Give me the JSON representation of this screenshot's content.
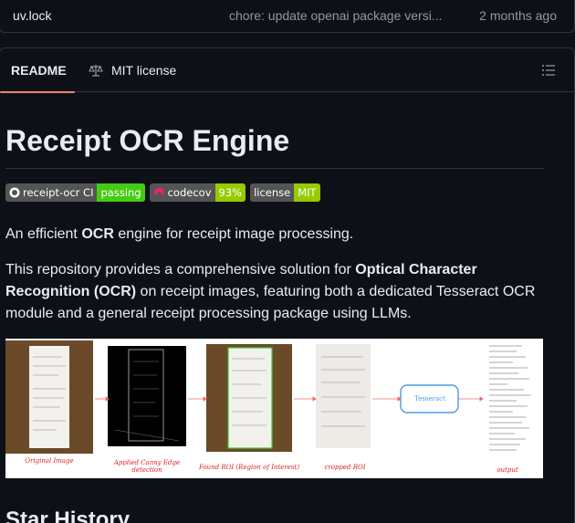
{
  "file_row": {
    "name": "uv.lock",
    "commit_message": "chore: update openai package versi...",
    "age": "2 months ago"
  },
  "tabs": {
    "readme": {
      "label": "README",
      "icon": "book-icon"
    },
    "license": {
      "label": "MIT license",
      "icon": "scale-icon"
    },
    "toc_icon": "list-icon"
  },
  "readme": {
    "title": "Receipt OCR Engine",
    "badges": [
      {
        "left": "receipt-ocr CI",
        "right": "passing",
        "color": "#4c1",
        "icon": "github-icon"
      },
      {
        "left": "codecov",
        "right": "93%",
        "color": "#97ca00",
        "icon": "codecov-icon"
      },
      {
        "left": "license",
        "right": "MIT",
        "color": "#97ca00"
      }
    ],
    "p1": {
      "pre": "An efficient ",
      "bold": "OCR",
      "post": " engine for receipt image processing."
    },
    "p2": {
      "pre": "This repository provides a comprehensive solution for ",
      "bold": "Optical Character Recognition (OCR)",
      "post": " on receipt images, featuring both a dedicated Tesseract OCR module and a general receipt processing package using LLMs."
    },
    "pipeline": {
      "stages": [
        "Original Image",
        "Applied Canny Edge detection",
        "Found ROI (Region of Interest)",
        "cropped ROI",
        "Tesseract",
        "output"
      ]
    },
    "h2": "Star History"
  },
  "colors": {
    "bg": "#0d1117",
    "border": "#30363d",
    "tab_underline": "#f78166",
    "muted": "#9198a1"
  }
}
